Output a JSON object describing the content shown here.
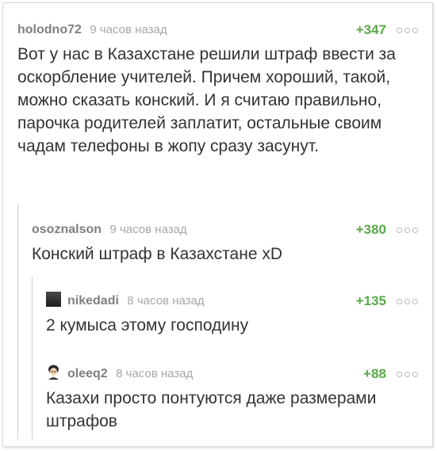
{
  "comments": [
    {
      "user": "holodno72",
      "time": "9 часов назад",
      "rating": "+347",
      "text": "Вот у нас в Казахстане решили штраф ввести за оскорбление учителей. Причем хороший, такой, можно сказать конский. И я считаю правильно, парочка родителей заплатит, остальные своим чадам телефоны в жопу сразу засунут."
    },
    {
      "user": "osoznalson",
      "time": "9 часов назад",
      "rating": "+380",
      "text": "Конский штраф в Казахстане xD"
    },
    {
      "user": "nikedadi",
      "time": "8 часов назад",
      "rating": "+135",
      "text": "2 кумыса этому господину"
    },
    {
      "user": "oleeq2",
      "time": "8 часов назад",
      "rating": "+88",
      "text": "Казахи просто понтуются даже размерами штрафов"
    }
  ],
  "colors": {
    "rating": "#5aa84a",
    "username": "#7f7f7f",
    "time": "#a7a7a7",
    "text": "#333333"
  },
  "icons": {
    "more": "more-dots-icon",
    "avatar": "avatar-icon"
  }
}
